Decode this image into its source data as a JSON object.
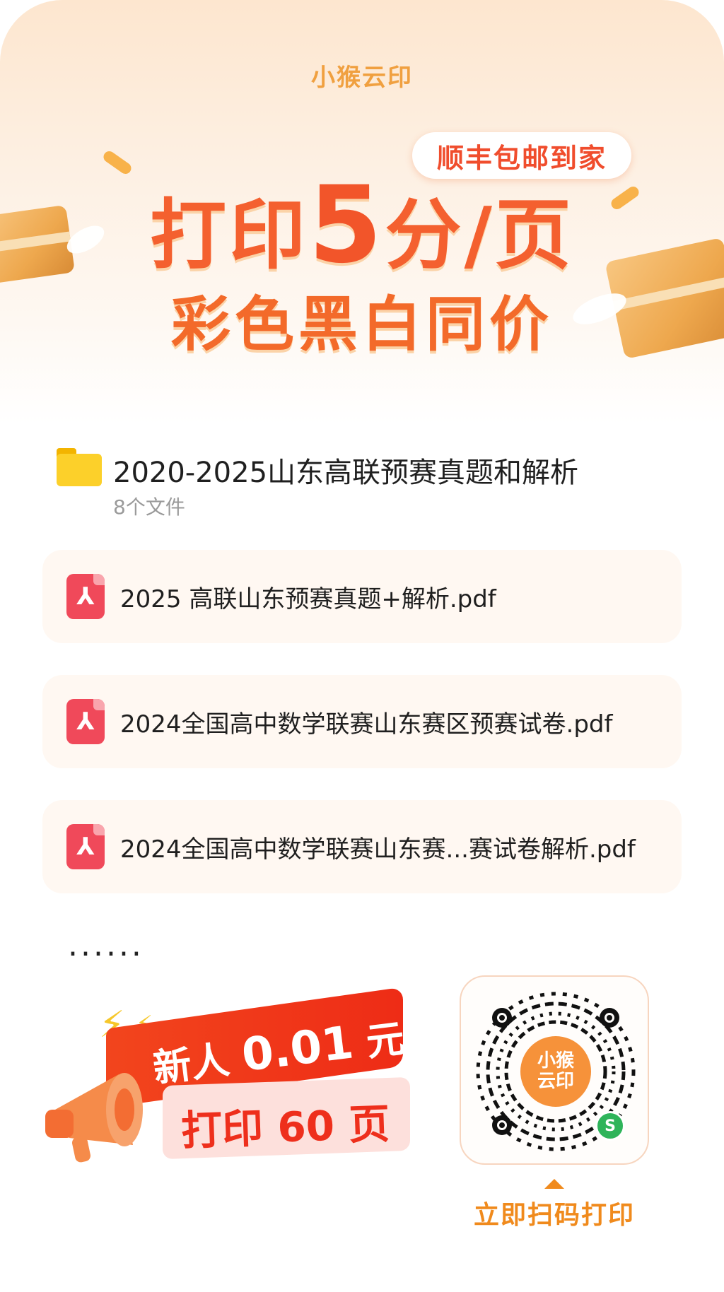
{
  "header": {
    "brand": "小猴云印",
    "badge": "顺丰包邮到家",
    "headline_prefix": "打印",
    "headline_number": "5",
    "headline_suffix": "分/页",
    "subline": "彩色黑白同价"
  },
  "folder": {
    "icon": "folder-icon",
    "title": "2020-2025山东高联预赛真题和解析",
    "count": "8个文件"
  },
  "files": [
    {
      "icon": "pdf-icon",
      "name": "2025 高联山东预赛真题+解析.pdf"
    },
    {
      "icon": "pdf-icon",
      "name": "2024全国高中数学联赛山东赛区预赛试卷.pdf"
    },
    {
      "icon": "pdf-icon",
      "name": "2024全国高中数学联赛山东赛...赛试卷解析.pdf"
    }
  ],
  "more": "......",
  "promo": {
    "line1_prefix": "新人",
    "line1_price": "0.01",
    "line1_unit": "元",
    "line2_prefix": "打印",
    "line2_number": "60",
    "line2_unit": "页"
  },
  "qr": {
    "center_line1": "小猴",
    "center_line2": "云印",
    "badge_icon": "mini-program-icon",
    "badge_glyph": "S",
    "cta": "立即扫码打印"
  },
  "colors": {
    "accent_orange": "#f4602f",
    "promo_red": "#ee2c16",
    "pdf_red": "#f0495a",
    "folder_yellow": "#fcd02a",
    "cta_orange": "#f08a1c"
  }
}
